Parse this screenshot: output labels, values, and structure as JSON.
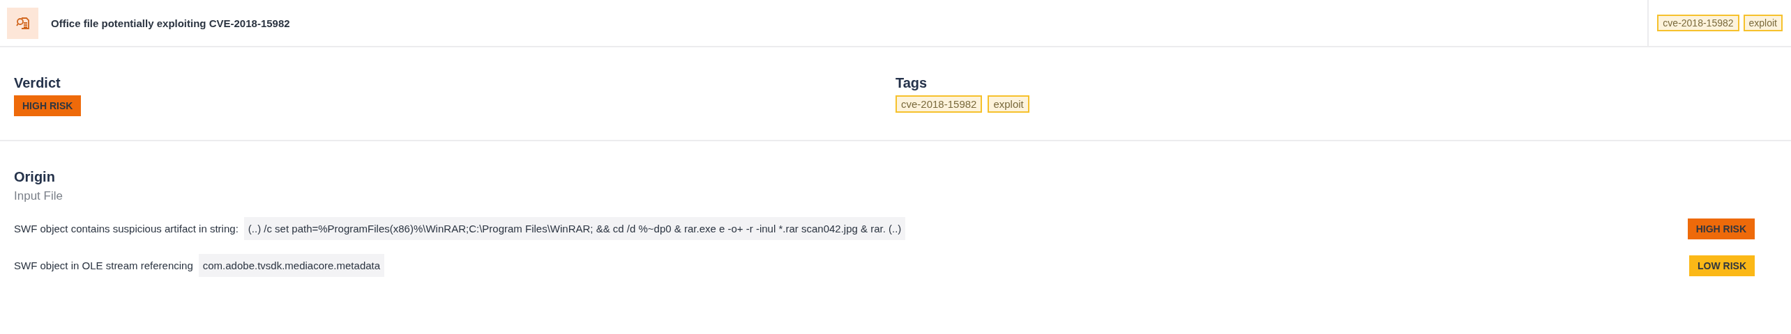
{
  "header": {
    "title": "Office file potentially exploiting CVE-2018-15982",
    "tags": [
      "cve-2018-15982",
      "exploit"
    ]
  },
  "verdict": {
    "label": "Verdict",
    "risk": {
      "kind": "high",
      "text": "HIGH RISK"
    }
  },
  "tags_section": {
    "label": "Tags",
    "tags": [
      "cve-2018-15982",
      "exploit"
    ]
  },
  "origin": {
    "label": "Origin",
    "source": "Input File"
  },
  "findings": [
    {
      "text": "SWF object contains suspicious artifact in string:",
      "code": "(..) /c set path=%ProgramFiles(x86)%\\WinRAR;C:\\Program Files\\WinRAR; && cd /d %~dp0 & rar.exe e -o+ -r -inul *.rar scan042.jpg & rar. (..)",
      "risk": {
        "kind": "high",
        "text": "HIGH RISK"
      }
    },
    {
      "text": "SWF object in OLE stream referencing",
      "code": "com.adobe.tvsdk.mediacore.metadata",
      "risk": {
        "kind": "low",
        "text": "LOW RISK"
      }
    }
  ]
}
